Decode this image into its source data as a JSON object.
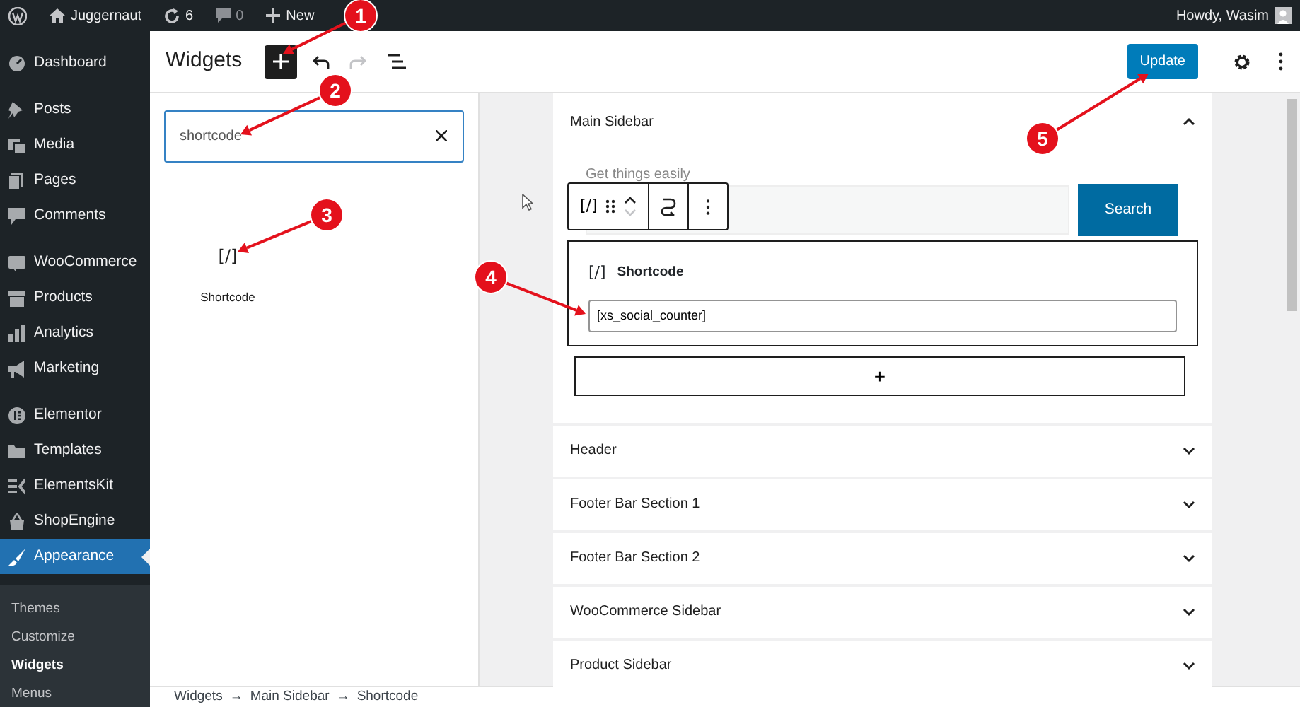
{
  "admin_bar": {
    "site_name": "Juggernaut",
    "updates": "6",
    "comments": "0",
    "new_label": "New",
    "greeting": "Howdy, Wasim"
  },
  "sidebar": {
    "groups": [
      {
        "items": [
          {
            "label": "Dashboard",
            "selected": false
          }
        ]
      },
      {
        "items": [
          {
            "label": "Posts",
            "selected": false
          },
          {
            "label": "Media",
            "selected": false
          },
          {
            "label": "Pages",
            "selected": false
          },
          {
            "label": "Comments",
            "selected": false
          }
        ]
      },
      {
        "items": [
          {
            "label": "WooCommerce",
            "selected": false
          },
          {
            "label": "Products",
            "selected": false
          },
          {
            "label": "Analytics",
            "selected": false
          },
          {
            "label": "Marketing",
            "selected": false
          }
        ]
      },
      {
        "items": [
          {
            "label": "Elementor",
            "selected": false
          },
          {
            "label": "Templates",
            "selected": false
          },
          {
            "label": "ElementsKit",
            "selected": false
          },
          {
            "label": "ShopEngine",
            "selected": false
          },
          {
            "label": "Appearance",
            "selected": true
          }
        ]
      }
    ],
    "submenu": [
      {
        "label": "Themes",
        "selected": false
      },
      {
        "label": "Customize",
        "selected": false
      },
      {
        "label": "Widgets",
        "selected": true
      },
      {
        "label": "Menus",
        "selected": false
      }
    ]
  },
  "header": {
    "title": "Widgets",
    "inserter_open": true,
    "redo_disabled": true,
    "update_label": "Update"
  },
  "inserter": {
    "search": {
      "value": "shortcode"
    },
    "blocks": [
      {
        "icon_text": "[/]",
        "label": "Shortcode"
      }
    ]
  },
  "block_toolbar": {
    "icon_text": "[/]",
    "move_down_disabled": true
  },
  "widget_areas": [
    {
      "title": "Main Sidebar",
      "expanded": true
    },
    {
      "title": "Header",
      "expanded": false
    },
    {
      "title": "Footer Bar Section 1",
      "expanded": false
    },
    {
      "title": "Footer Bar Section 2",
      "expanded": false
    },
    {
      "title": "WooCommerce Sidebar",
      "expanded": false
    },
    {
      "title": "Product Sidebar",
      "expanded": false
    }
  ],
  "main_area": {
    "search_widget": {
      "heading": "Get things easily",
      "button": "Search"
    },
    "shortcode_block": {
      "icon_text": "[/]",
      "title": "Shortcode",
      "value": "[xs_social_counter]"
    },
    "appender": "+"
  },
  "breadcrumb": [
    {
      "label": "Widgets",
      "separator": "→"
    },
    {
      "label": "Main Sidebar",
      "separator": "→"
    },
    {
      "label": "Shortcode"
    }
  ],
  "annotations": [
    {
      "label": "1"
    },
    {
      "label": "2"
    },
    {
      "label": "3"
    },
    {
      "label": "4"
    },
    {
      "label": "5"
    }
  ]
}
